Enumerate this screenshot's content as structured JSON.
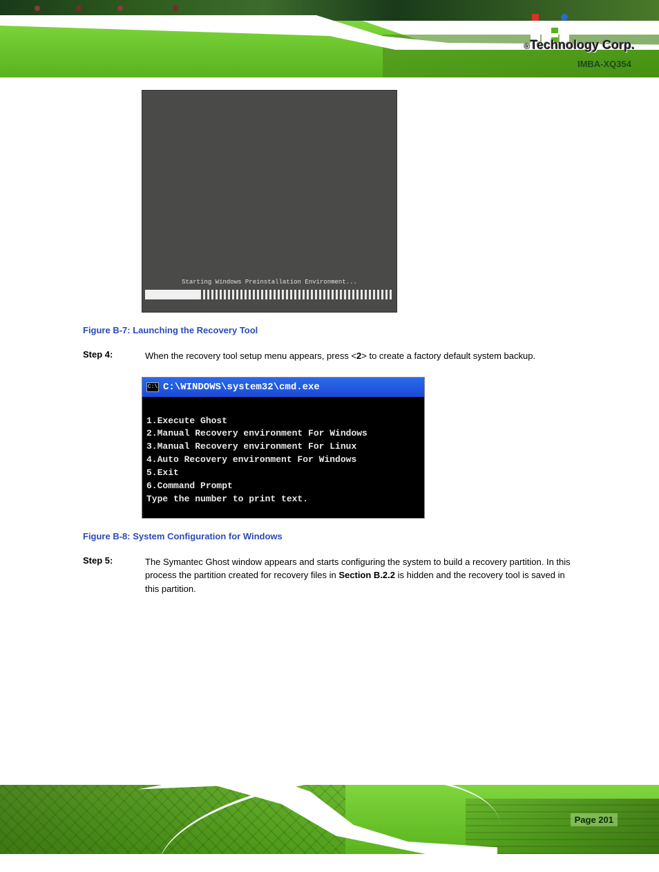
{
  "brand": {
    "reg": "®",
    "text": "Technology Corp."
  },
  "doc_title": "IMBA-XQ354",
  "fig1": {
    "boot_text": "Starting Windows Preinstallation Environment...",
    "caption": "Figure B-7: Launching the Recovery Tool"
  },
  "step4": {
    "num": "Step 4:",
    "text": "When the recovery tool setup menu appears, press <",
    "key": "2",
    "text2": "> to create a factory default system backup."
  },
  "fig2": {
    "title": "C:\\WINDOWS\\system32\\cmd.exe",
    "icon": "C:\\",
    "lines": [
      "1.Execute Ghost",
      "2.Manual Recovery environment For Windows",
      "3.Manual Recovery environment For Linux",
      "4.Auto Recovery environment For Windows",
      "5.Exit",
      "6.Command Prompt",
      "Type the number to print text."
    ],
    "caption": "Figure B-8: System Configuration for Windows"
  },
  "step5": {
    "num": "Step 5:",
    "text": "The Symantec Ghost window appears and starts configuring the system to build a recovery partition. In this process the partition created for recovery files in ",
    "ref": "Section B.2.2",
    "text2": " is hidden and the recovery tool is saved in this partition."
  },
  "page_label": "Page 201"
}
